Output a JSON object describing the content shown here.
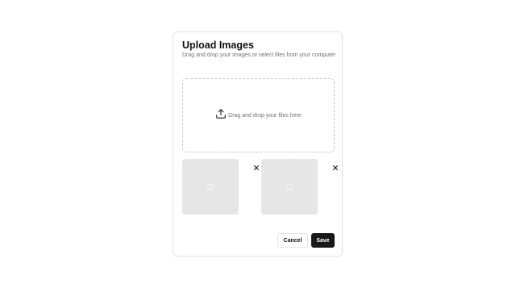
{
  "dialog": {
    "title": "Upload Images",
    "subtitle": "Drag and drop your images or select files from your computer"
  },
  "dropzone": {
    "icon": "upload-icon",
    "text": "Drag and drop your files here"
  },
  "thumbnails": [
    {
      "state": "loading",
      "remove_icon": "close-icon"
    },
    {
      "state": "loading",
      "remove_icon": "close-icon"
    }
  ],
  "actions": {
    "cancel_label": "Cancel",
    "save_label": "Save"
  },
  "colors": {
    "primary_button": "#18181b",
    "thumbnail_placeholder": "#e6e6e6",
    "muted_text": "#71717a",
    "border": "#e4e4e7"
  }
}
